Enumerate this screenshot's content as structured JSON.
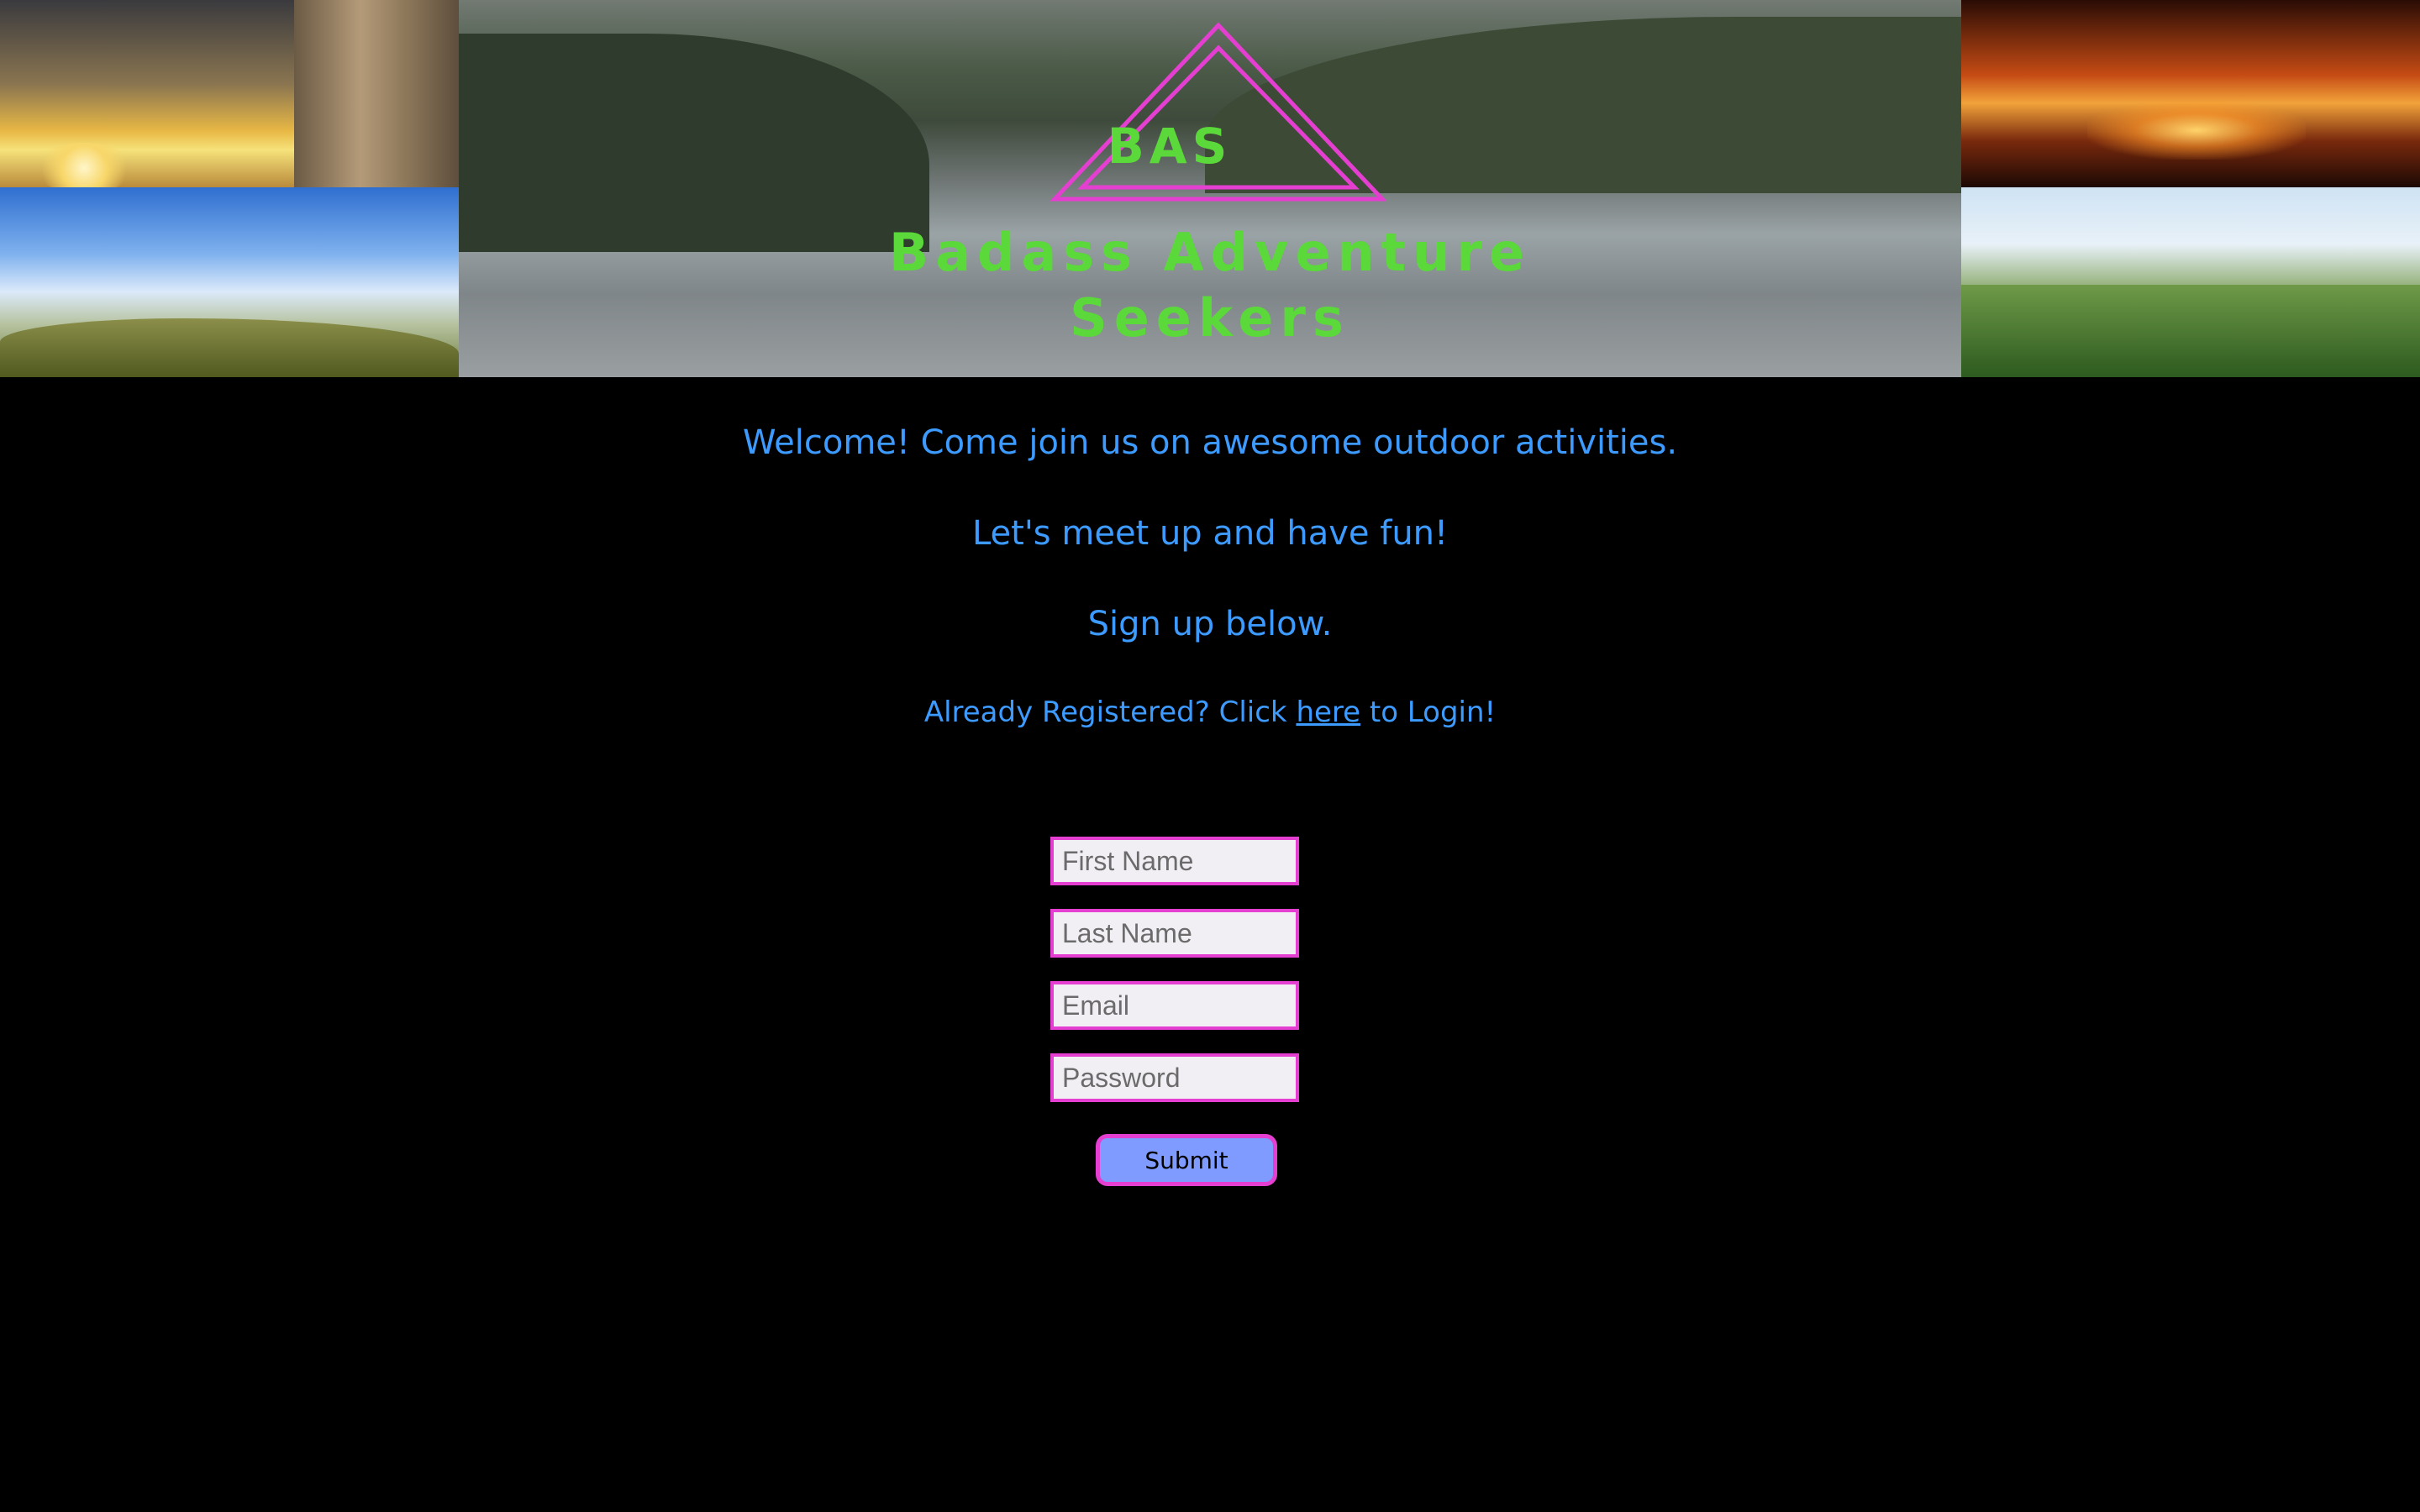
{
  "banner": {
    "abbr": "BAS",
    "name_line1": "Badass Adventure",
    "name_line2": "Seekers",
    "logo_color": "#e43fd0",
    "text_color": "#5bd83a"
  },
  "intro": {
    "welcome": "Welcome! Come join us on awesome outdoor activities.",
    "meet": "Let's meet up and have fun!",
    "signup": "Sign up below.",
    "already_prefix": "Already Registered? Click ",
    "already_link": "here",
    "already_suffix": " to Login!",
    "text_color": "#3d9bff"
  },
  "form": {
    "first_name_placeholder": "First Name",
    "last_name_placeholder": "Last Name",
    "email_placeholder": "Email",
    "password_placeholder": "Password",
    "submit_label": "Submit"
  }
}
